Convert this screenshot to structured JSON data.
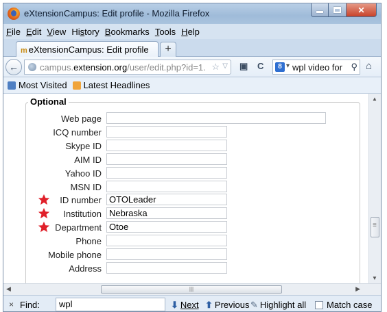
{
  "window": {
    "title": "eXtensionCampus: Edit profile - Mozilla Firefox"
  },
  "menu": [
    "File",
    "Edit",
    "View",
    "History",
    "Bookmarks",
    "Tools",
    "Help"
  ],
  "menu_underline": [
    "F",
    "E",
    "V",
    "s",
    "B",
    "T",
    "H"
  ],
  "tab": {
    "label": "eXtensionCampus: Edit profile",
    "new_tab": "+"
  },
  "url": {
    "prefix": "campus.",
    "domain": "extension.org",
    "path": "/user/edit.php?id=1."
  },
  "search": {
    "value": "wpl video for",
    "engine": "8"
  },
  "bookmarks": [
    "Most Visited",
    "Latest Headlines"
  ],
  "section": {
    "legend": "Optional"
  },
  "fields": [
    {
      "label": "Web page",
      "value": "",
      "required": false,
      "wide": true
    },
    {
      "label": "ICQ number",
      "value": "",
      "required": false
    },
    {
      "label": "Skype ID",
      "value": "",
      "required": false
    },
    {
      "label": "AIM ID",
      "value": "",
      "required": false
    },
    {
      "label": "Yahoo ID",
      "value": "",
      "required": false
    },
    {
      "label": "MSN ID",
      "value": "",
      "required": false
    },
    {
      "label": "ID number",
      "value": "OTOLeader",
      "required": true
    },
    {
      "label": "Institution",
      "value": "Nebraska",
      "required": true
    },
    {
      "label": "Department",
      "value": "Otoe",
      "required": true
    },
    {
      "label": "Phone",
      "value": "",
      "required": false
    },
    {
      "label": "Mobile phone",
      "value": "",
      "required": false
    },
    {
      "label": "Address",
      "value": "",
      "required": false
    }
  ],
  "findbar": {
    "close": "×",
    "label": "Find:",
    "value": "wpl",
    "next": "Next",
    "previous": "Previous",
    "highlight_all": "Highlight all",
    "match_case": "Match case"
  },
  "colors": {
    "required_star": "#e0202a",
    "chrome_blue": "#cbdbed"
  }
}
